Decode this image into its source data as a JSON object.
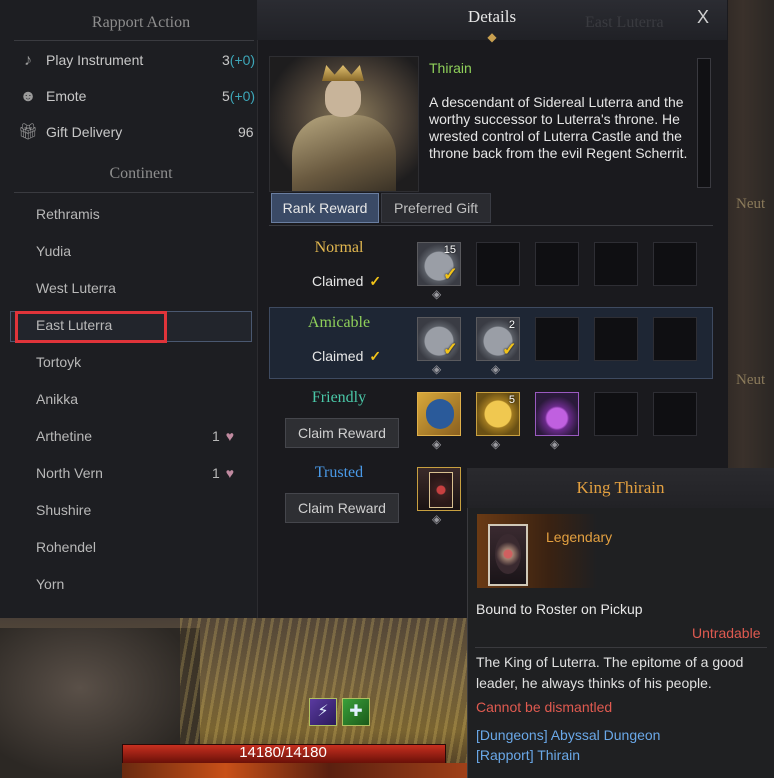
{
  "left_panel": {
    "rapport_title": "Rapport Action",
    "actions": [
      {
        "label": "Play Instrument",
        "value": "3",
        "plus": "(+0)",
        "icon": "music-note-icon"
      },
      {
        "label": "Emote",
        "value": "5",
        "plus": "(+0)",
        "icon": "emote-icon"
      },
      {
        "label": "Gift Delivery",
        "value": "96",
        "plus": "",
        "icon": "gift-icon"
      }
    ],
    "continent_title": "Continent",
    "continents": [
      {
        "label": "Rethramis"
      },
      {
        "label": "Yudia"
      },
      {
        "label": "West Luterra"
      },
      {
        "label": "East Luterra",
        "selected": true
      },
      {
        "label": "Tortoyk"
      },
      {
        "label": "Anikka"
      },
      {
        "label": "Arthetine",
        "count": "1"
      },
      {
        "label": "North Vern",
        "count": "1"
      },
      {
        "label": "Shushire"
      },
      {
        "label": "Rohendel"
      },
      {
        "label": "Yorn"
      }
    ]
  },
  "details": {
    "title": "Details",
    "close": "X",
    "background_label": "East Luterra",
    "npc_name": "Thirain",
    "npc_description": "A descendant of Sidereal Luterra and the worthy successor to Luterra's throne. He wrested control of Luterra Castle and the throne back from the evil Regent Scherrit.",
    "tabs": [
      "Rank Reward",
      "Preferred Gift"
    ],
    "active_tab": "Rank Reward",
    "tiers": [
      {
        "name": "Normal",
        "color": "#e3b850",
        "status": "Claimed",
        "rewards": [
          {
            "type": "coin",
            "count": "15",
            "claimed": true
          }
        ]
      },
      {
        "name": "Amicable",
        "color": "#8fd05a",
        "status": "Claimed",
        "rewards": [
          {
            "type": "coin",
            "count": "",
            "claimed": true
          },
          {
            "type": "coin",
            "count": "2",
            "claimed": true
          }
        ]
      },
      {
        "name": "Friendly",
        "color": "#4ac8a8",
        "status": "Claim Reward",
        "rewards": [
          {
            "type": "lion-emblem",
            "count": ""
          },
          {
            "type": "gold-coin",
            "count": "5"
          },
          {
            "type": "potion",
            "count": ""
          }
        ]
      },
      {
        "name": "Trusted",
        "color": "#4a9ae8",
        "status": "Claim Reward",
        "rewards": [
          {
            "type": "card",
            "count": ""
          }
        ]
      }
    ]
  },
  "tooltip": {
    "title": "King Thirain",
    "grade": "Legendary",
    "bound": "Bound to Roster on Pickup",
    "untradable": "Untradable",
    "description": "The King of Luterra. The epitome of a good leader, he always thinks of his people.",
    "not_dismantle": "Cannot be dismantled",
    "sources": [
      "[Dungeons] Abyssal Dungeon",
      "[Rapport] Thirain"
    ]
  },
  "right_labels": [
    "Neut",
    "Neut"
  ],
  "hud": {
    "hp": "14180/14180",
    "skills": [
      "skill-lightning-icon",
      "skill-heal-icon"
    ]
  },
  "colors": {
    "accent": "#e3a040",
    "claimed_check": "#f2c318",
    "highlight_border": "#e0343a"
  }
}
